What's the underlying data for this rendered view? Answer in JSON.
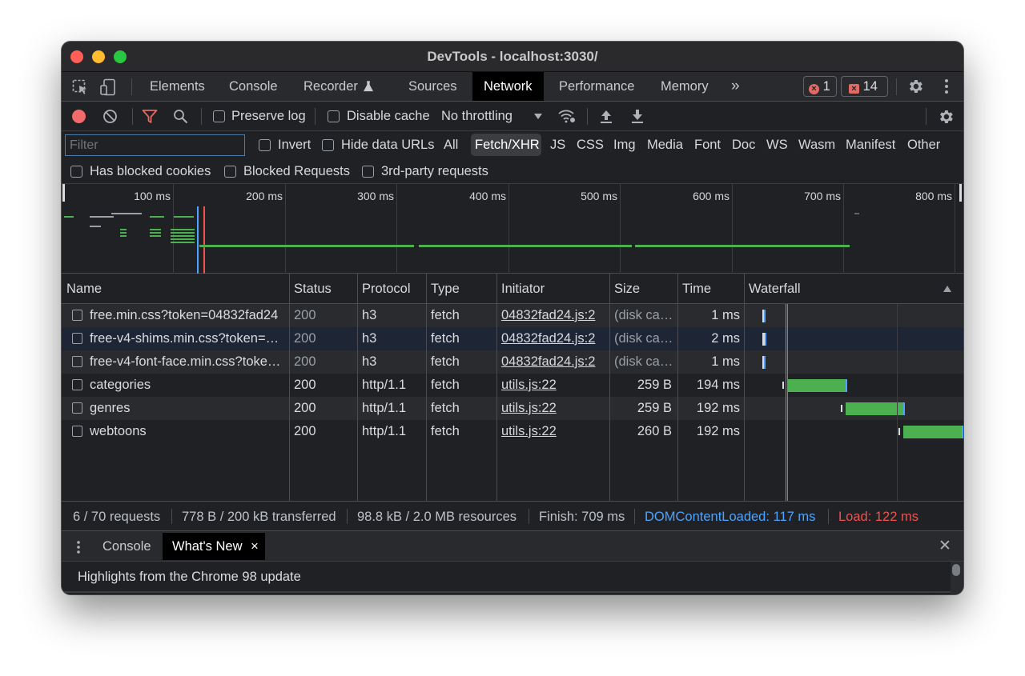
{
  "window": {
    "title": "DevTools - localhost:3030/"
  },
  "tabs": [
    "Elements",
    "Console",
    "Recorder",
    "Sources",
    "Network",
    "Performance",
    "Memory"
  ],
  "tabs_active": "Network",
  "tabs_more": "»",
  "badges": {
    "errors": "1",
    "issues": "14"
  },
  "toolbar": {
    "preserve_log": "Preserve log",
    "disable_cache": "Disable cache",
    "throttling": "No throttling"
  },
  "filter": {
    "placeholder": "Filter",
    "invert": "Invert",
    "hide_data_urls": "Hide data URLs",
    "types": [
      "All",
      "Fetch/XHR",
      "JS",
      "CSS",
      "Img",
      "Media",
      "Font",
      "Doc",
      "WS",
      "Wasm",
      "Manifest",
      "Other"
    ],
    "active_type": "Fetch/XHR",
    "has_blocked_cookies": "Has blocked cookies",
    "blocked_requests": "Blocked Requests",
    "third_party": "3rd-party requests"
  },
  "overview": {
    "ticks": [
      "100 ms",
      "200 ms",
      "300 ms",
      "400 ms",
      "500 ms",
      "600 ms",
      "700 ms",
      "800 ms"
    ]
  },
  "table": {
    "columns": [
      "Name",
      "Status",
      "Protocol",
      "Type",
      "Initiator",
      "Size",
      "Time",
      "Waterfall"
    ],
    "rows": [
      {
        "name": "free.min.css?token=04832fad24",
        "status": "200",
        "protocol": "h3",
        "type": "fetch",
        "initiator": "04832fad24.js:2",
        "size": "(disk ca…",
        "time": "1 ms"
      },
      {
        "name": "free-v4-shims.min.css?token=…",
        "status": "200",
        "protocol": "h3",
        "type": "fetch",
        "initiator": "04832fad24.js:2",
        "size": "(disk ca…",
        "time": "2 ms"
      },
      {
        "name": "free-v4-font-face.min.css?toke…",
        "status": "200",
        "protocol": "h3",
        "type": "fetch",
        "initiator": "04832fad24.js:2",
        "size": "(disk ca…",
        "time": "1 ms"
      },
      {
        "name": "categories",
        "status": "200",
        "protocol": "http/1.1",
        "type": "fetch",
        "initiator": "utils.js:22",
        "size": "259 B",
        "time": "194 ms"
      },
      {
        "name": "genres",
        "status": "200",
        "protocol": "http/1.1",
        "type": "fetch",
        "initiator": "utils.js:22",
        "size": "259 B",
        "time": "192 ms"
      },
      {
        "name": "webtoons",
        "status": "200",
        "protocol": "http/1.1",
        "type": "fetch",
        "initiator": "utils.js:22",
        "size": "260 B",
        "time": "192 ms"
      }
    ]
  },
  "status": {
    "requests": "6 / 70 requests",
    "transferred": "778 B / 200 kB transferred",
    "resources": "98.8 kB / 2.0 MB resources",
    "finish": "Finish: 709 ms",
    "dcl": "DOMContentLoaded: 117 ms",
    "load": "Load: 122 ms"
  },
  "drawer": {
    "tabs": [
      "Console",
      "What's New"
    ],
    "active": "What's New",
    "close_glyph": "×",
    "close_drawer": "✕",
    "headline": "Highlights from the Chrome 98 update"
  },
  "colors": {
    "accent_blue": "#4da3ff",
    "load_red": "#ef5350",
    "waterfall_green": "#4caf50",
    "record_red": "#f26b6b"
  }
}
